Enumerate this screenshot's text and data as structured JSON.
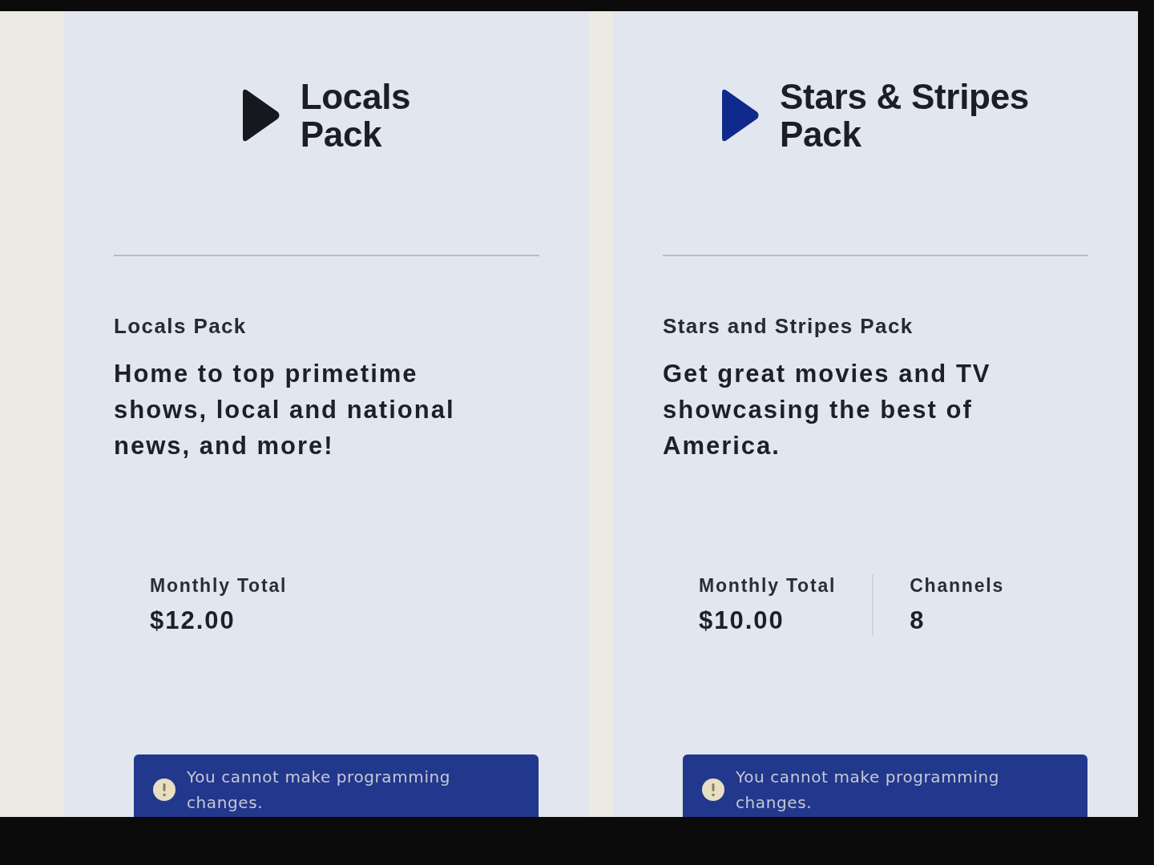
{
  "packs": [
    {
      "logo": {
        "color": "#16181f",
        "title_lines": [
          "Locals",
          "Pack"
        ]
      },
      "name": "Locals Pack",
      "description": "Home to top primetime shows, local and national news, and more!",
      "stats": [
        {
          "label": "Monthly Total",
          "value": "$12.00"
        }
      ],
      "notice": {
        "text": "You cannot make programming changes."
      }
    },
    {
      "logo": {
        "color": "#0f2a8c",
        "title_lines": [
          "Stars & Stripes",
          "Pack"
        ]
      },
      "name": "Stars and Stripes Pack",
      "description": "Get great movies and TV showcasing the best of America.",
      "stats": [
        {
          "label": "Monthly Total",
          "value": "$10.00"
        },
        {
          "label": "Channels",
          "value": "8"
        }
      ],
      "notice": {
        "text": "You cannot make programming changes."
      }
    }
  ]
}
